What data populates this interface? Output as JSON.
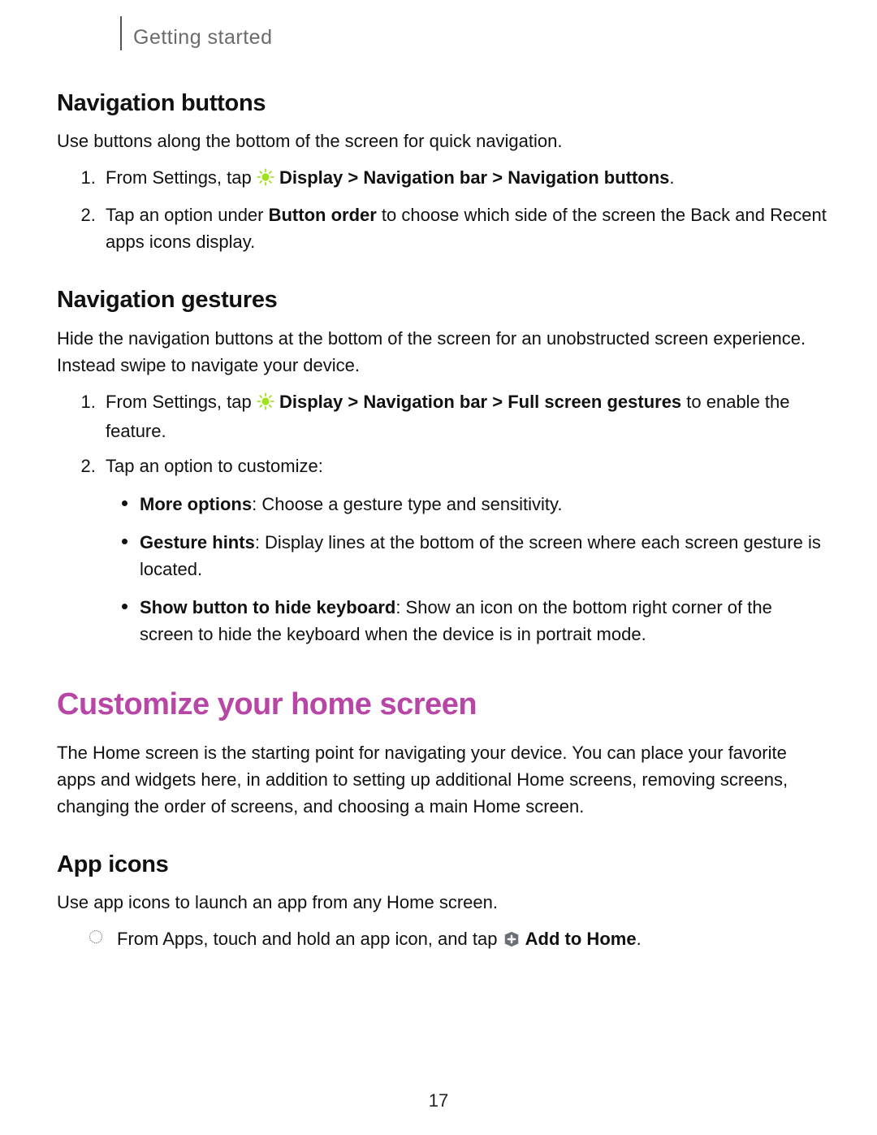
{
  "breadcrumb": "Getting started",
  "page_number": "17",
  "sections": {
    "nav_buttons": {
      "heading": "Navigation buttons",
      "intro": "Use buttons along the bottom of the screen for quick navigation.",
      "step1_pre": "From Settings, tap ",
      "step1_bold": "Display > Navigation bar > Navigation buttons",
      "step1_post": ".",
      "step2_pre": "Tap an option under ",
      "step2_bold": "Button order",
      "step2_post": " to choose which side of the screen the Back and Recent apps icons display."
    },
    "nav_gestures": {
      "heading": "Navigation gestures",
      "intro": "Hide the navigation buttons at the bottom of the screen for an unobstructed screen experience. Instead swipe to navigate your device.",
      "step1_pre": "From Settings, tap ",
      "step1_bold": "Display > Navigation bar > Full screen gestures",
      "step1_post": " to enable the feature.",
      "step2": "Tap an option to customize:",
      "opt1_bold": "More options",
      "opt1_rest": ": Choose a gesture type and sensitivity.",
      "opt2_bold": "Gesture hints",
      "opt2_rest": ": Display lines at the bottom of the screen where each screen gesture is located.",
      "opt3_bold": "Show button to hide keyboard",
      "opt3_rest": ": Show an icon on the bottom right corner of the screen to hide the keyboard when the device is in portrait mode."
    },
    "customize_home": {
      "heading": "Customize your home screen",
      "intro": "The Home screen is the starting point for navigating your device. You can place your favorite apps and widgets here, in addition to setting up additional Home screens, removing screens, changing the order of screens, and choosing a main Home screen."
    },
    "app_icons": {
      "heading": "App icons",
      "intro": "Use app icons to launch an app from any Home screen.",
      "step_pre": "From Apps, touch and hold an app icon, and tap ",
      "step_bold": "Add to Home",
      "step_post": "."
    }
  }
}
